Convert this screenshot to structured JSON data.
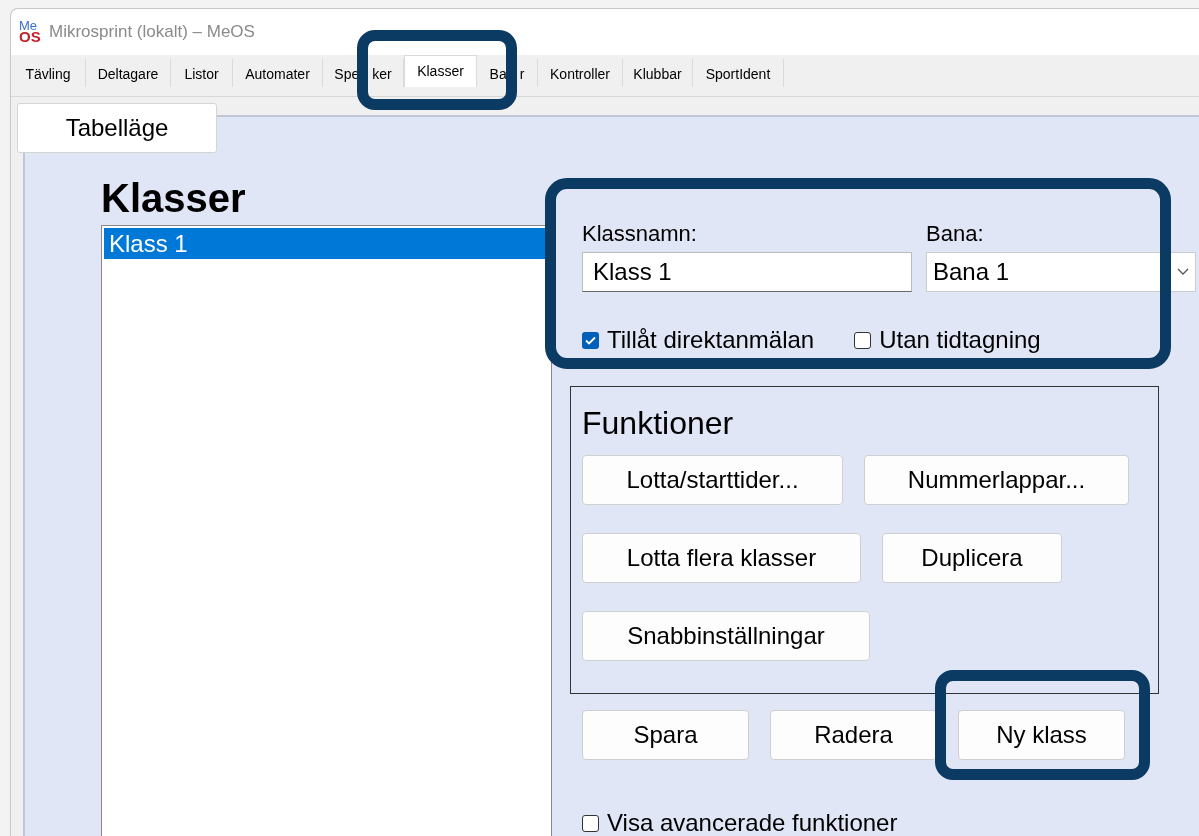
{
  "window": {
    "title": "Mikrosprint (lokalt) – MeOS",
    "logo_top": "Me",
    "logo_bottom": "OS"
  },
  "tabs": [
    {
      "label": "Tävling",
      "selected": false
    },
    {
      "label": "Deltagare",
      "selected": false
    },
    {
      "label": "Listor",
      "selected": false
    },
    {
      "label": "Automater",
      "selected": false
    },
    {
      "label_parts": [
        "Spe",
        "ker"
      ],
      "selected": false
    },
    {
      "label": "Klasser",
      "selected": true
    },
    {
      "label_parts": [
        "Ba",
        "r"
      ],
      "selected": false
    },
    {
      "label": "Kontroller",
      "selected": false
    },
    {
      "label": "Klubbar",
      "selected": false
    },
    {
      "label": "SportIdent",
      "selected": false
    }
  ],
  "table_mode_button": "Tabelläge",
  "heading": "Klasser",
  "class_list": [
    {
      "label": "Klass 1",
      "selected": true
    }
  ],
  "form": {
    "name_label": "Klassnamn:",
    "name_value": "Klass 1",
    "course_label": "Bana:",
    "course_value": "Bana 1",
    "checkboxes": [
      {
        "label": "Tillåt direktanmälan",
        "checked": true
      },
      {
        "label": "Utan tidtagning",
        "checked": false
      }
    ]
  },
  "functions": {
    "title": "Funktioner",
    "buttons": [
      "Lotta/starttider...",
      "Nummerlappar...",
      "Lotta flera klasser",
      "Duplicera",
      "Snabbinställningar"
    ]
  },
  "actions": [
    "Spara",
    "Radera",
    "Ny klass"
  ],
  "advanced": {
    "label": "Visa avancerade funktioner",
    "checked": false
  }
}
